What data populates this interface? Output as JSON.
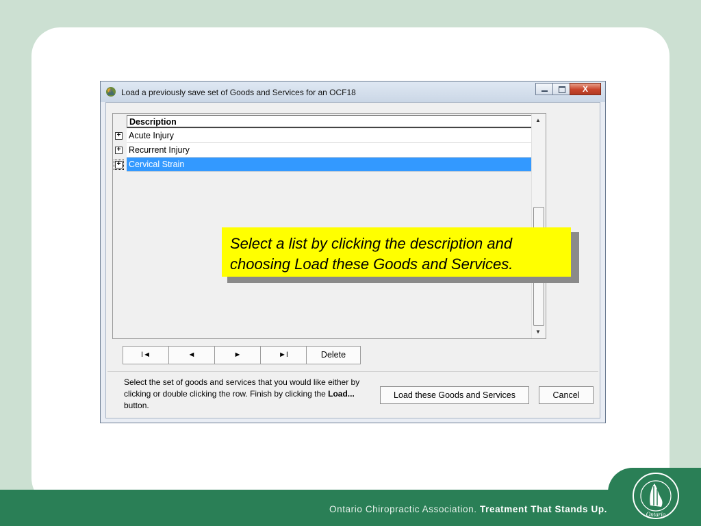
{
  "window": {
    "title": "Load a previously save set of Goods and Services for an OCF18",
    "close_glyph": "X"
  },
  "grid": {
    "column_header": "Description",
    "rows": [
      {
        "expander": "+",
        "label": "Acute Injury"
      },
      {
        "expander": "+",
        "label": "Recurrent Injury"
      },
      {
        "expander": "+",
        "label": "Cervical Strain",
        "selected": true
      }
    ],
    "scroll_up": "▲",
    "scroll_down": "▼"
  },
  "nav": {
    "first": "I◄",
    "prev": "◄",
    "next": "►",
    "last": "►I",
    "delete": "Delete"
  },
  "help": {
    "text_before": "Select the set of goods and services that you would like either by clicking or double clicking the row. Finish by clicking the ",
    "bold": "Load...",
    "text_after": " button."
  },
  "buttons": {
    "load": "Load these Goods and Services",
    "cancel": "Cancel"
  },
  "callout": {
    "text": "Select a list by clicking the description and choosing Load these Goods and Services."
  },
  "footer": {
    "org": "Ontario Chiropractic Association.",
    "tagline": "Treatment That Stands Up."
  },
  "logo": {
    "ring_top": "CHIROPRACTIC CHIROPRATIQUE",
    "ring_bottom": "Ontario"
  },
  "colors": {
    "footer_green": "#2a7f56",
    "selection_blue": "#3399ff",
    "callout_yellow": "#ffff00"
  }
}
